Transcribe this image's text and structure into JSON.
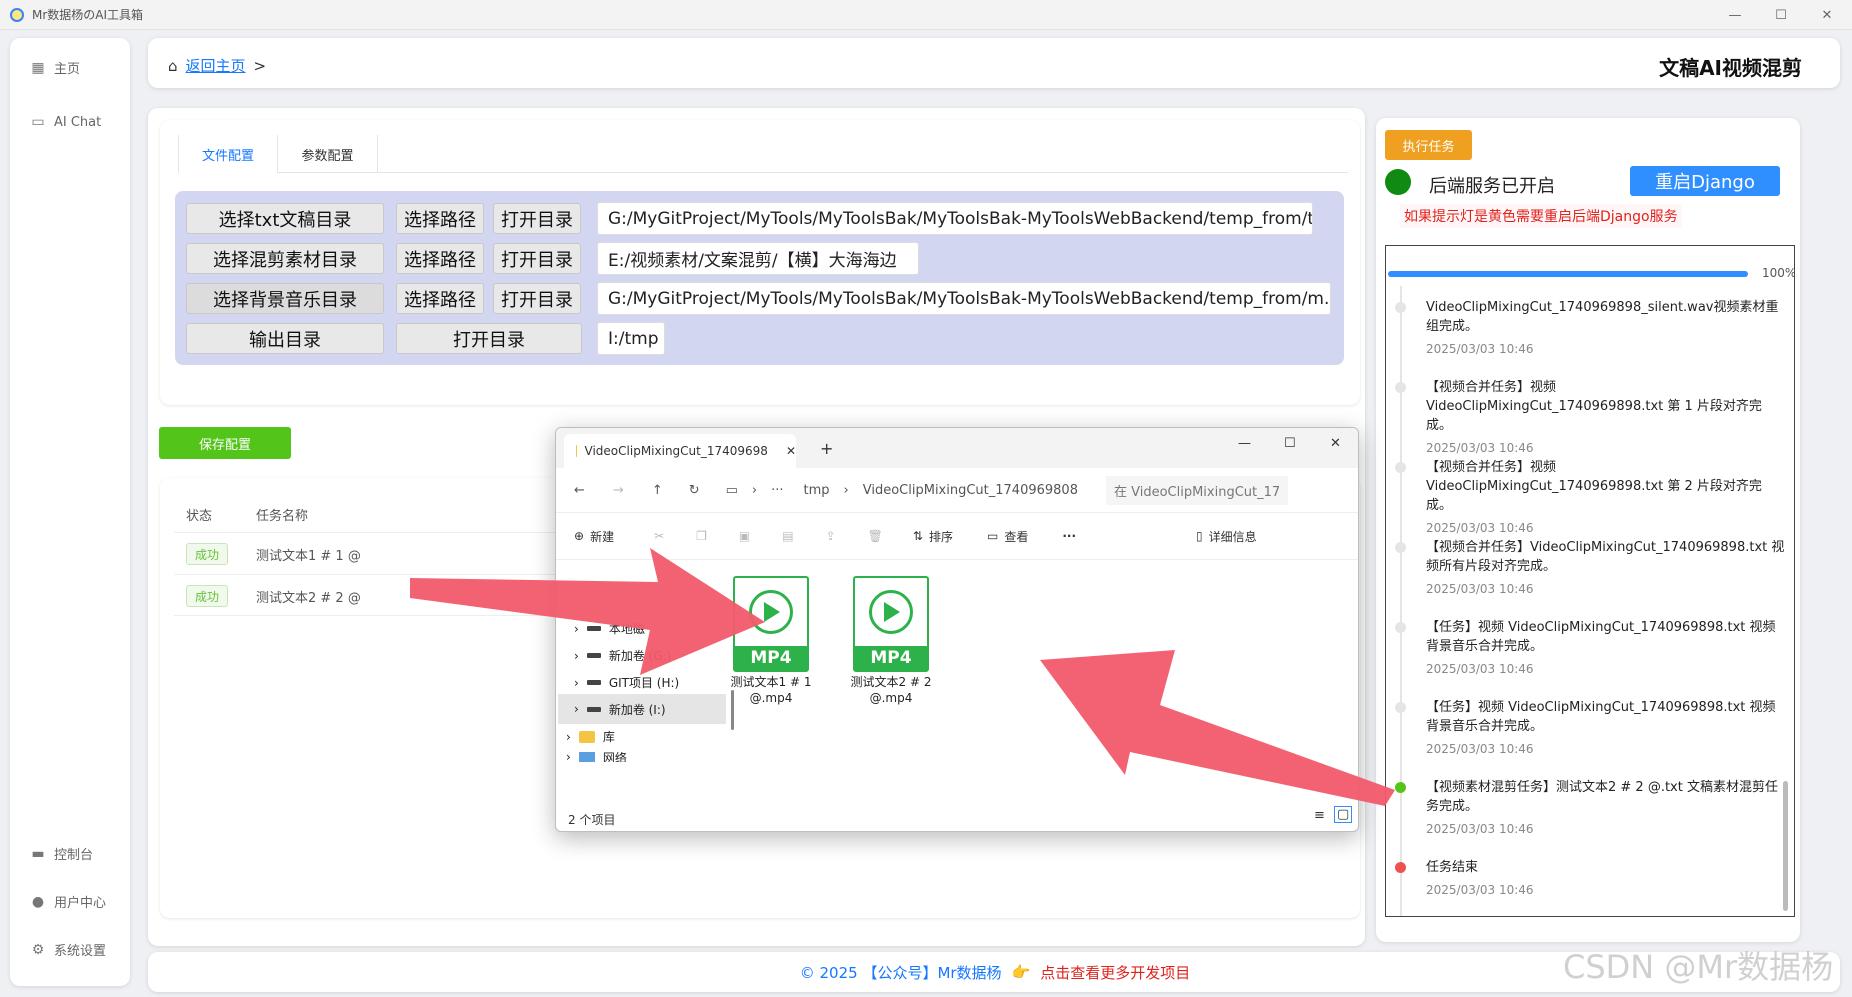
{
  "window": {
    "title": "Mr数据杨のAI工具箱"
  },
  "sidebar": {
    "items": [
      {
        "label": "主页",
        "icon": "grid-icon"
      },
      {
        "label": "AI Chat",
        "icon": "chat-icon"
      },
      {
        "label": "控制台",
        "icon": "monitor-icon"
      },
      {
        "label": "用户中心",
        "icon": "user-icon"
      },
      {
        "label": "系统设置",
        "icon": "gear-icon"
      }
    ]
  },
  "header": {
    "back_label": "返回主页",
    "separator": ">",
    "page_title": "文稿AI视频混剪"
  },
  "config": {
    "tabs": [
      {
        "label": "文件配置",
        "active": true
      },
      {
        "label": "参数配置",
        "active": false
      }
    ],
    "rows": [
      {
        "label": "选择txt文稿目录",
        "select": "选择路径",
        "open": "打开目录",
        "path": "G:/MyGitProject/MyTools/MyToolsBak/MyToolsBak-MyToolsWebBackend/temp_from/txt"
      },
      {
        "label": "选择混剪素材目录",
        "select": "选择路径",
        "open": "打开目录",
        "path": "E:/视频素材/文案混剪/【横】大海海边"
      },
      {
        "label": "选择背景音乐目录",
        "select": "选择路径",
        "open": "打开目录",
        "path": "G:/MyGitProject/MyTools/MyToolsBak/MyToolsBak-MyToolsWebBackend/temp_from/m..."
      },
      {
        "label": "输出目录",
        "open": "打开目录",
        "path": "I:/tmp"
      }
    ],
    "save_label": "保存配置"
  },
  "tasks": {
    "headers": [
      "状态",
      "任务名称"
    ],
    "rows": [
      {
        "status": "成功",
        "name": "测试文本1 # 1 @"
      },
      {
        "status": "成功",
        "name": "测试文本2 # 2 @"
      }
    ]
  },
  "panel": {
    "exec_label": "执行任务",
    "service_status": "后端服务已开启",
    "status_color": "#108a10",
    "restart_label": "重启Django",
    "warning": "如果提示灯是黄色需要重启后端Django服务",
    "progress": {
      "percent": 100,
      "label": "100%"
    },
    "logs": [
      {
        "text": "VideoClipMixingCut_1740969898_silent.wav视频素材重组完成。",
        "time": "2025/03/03 10:46",
        "dot": "#e5e5e5"
      },
      {
        "text": "【视频合并任务】视频 VideoClipMixingCut_1740969898.txt 第 1 片段对齐完成。",
        "time": "2025/03/03 10:46",
        "dot": "#e5e5e5"
      },
      {
        "text": "【视频合并任务】视频 VideoClipMixingCut_1740969898.txt 第 2 片段对齐完成。",
        "time": "2025/03/03 10:46",
        "dot": "#e5e5e5"
      },
      {
        "text": "【视频合并任务】VideoClipMixingCut_1740969898.txt 视频所有片段对齐完成。",
        "time": "2025/03/03 10:46",
        "dot": "#e5e5e5"
      },
      {
        "text": "【任务】视频 VideoClipMixingCut_1740969898.txt 视频背景音乐合并完成。",
        "time": "2025/03/03 10:46",
        "dot": "#e5e5e5"
      },
      {
        "text": "【任务】视频 VideoClipMixingCut_1740969898.txt 视频背景音乐合并完成。",
        "time": "2025/03/03 10:46",
        "dot": "#e5e5e5"
      },
      {
        "text": "【视频素材混剪任务】测试文本2 # 2 @.txt 文稿素材混剪任务完成。",
        "time": "2025/03/03 10:46",
        "dot": "#52c41a"
      },
      {
        "text": "任务结束",
        "time": "2025/03/03 10:46",
        "dot": "#f05050"
      }
    ]
  },
  "footer": {
    "copyright": "© 2025 【公众号】Mr数据杨",
    "link": "点击查看更多开发项目",
    "link_color": "#e0221c"
  },
  "watermark": "CSDN @Mr数据杨",
  "explorer": {
    "tab_title": "VideoClipMixingCut_17409698",
    "breadcrumb": [
      "tmp",
      "VideoClipMixingCut_1740969808"
    ],
    "search_placeholder": "在 VideoClipMixingCut_17",
    "toolbar": {
      "new": "新建",
      "sort": "排序",
      "view": "查看",
      "more": "···",
      "details": "详细信息"
    },
    "tree": [
      {
        "label": "本地磁"
      },
      {
        "label": "新加卷 (G:)"
      },
      {
        "label": "GIT项目 (H:)"
      },
      {
        "label": "新加卷 (I:)"
      },
      {
        "label": "库"
      },
      {
        "label": "网络"
      }
    ],
    "files": [
      {
        "badge": "MP4",
        "name": "测试文本1 # 1 @.mp4"
      },
      {
        "badge": "MP4",
        "name": "测试文本2 # 2 @.mp4"
      }
    ],
    "status": "2 个项目"
  }
}
